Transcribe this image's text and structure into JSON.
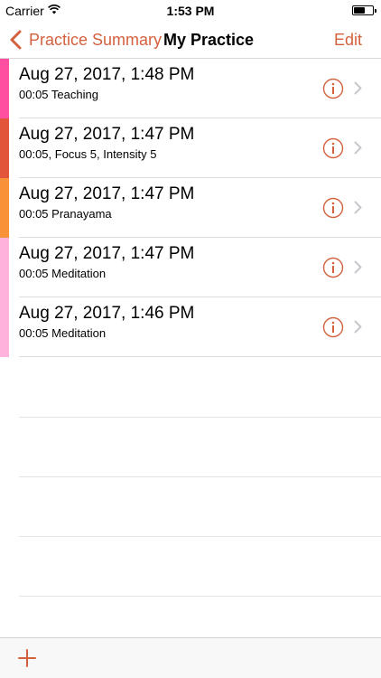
{
  "status_bar": {
    "carrier": "Carrier",
    "time": "1:53 PM",
    "battery_level": 0.6
  },
  "nav": {
    "back_label": "Practice Summary",
    "title": "My Practice",
    "edit_label": "Edit"
  },
  "colors": {
    "accent": "#d3613e"
  },
  "sessions": [
    {
      "title": "Aug 27, 2017, 1:48 PM",
      "subtitle": "00:05 Teaching",
      "color": "#ff4fa0"
    },
    {
      "title": "Aug 27, 2017, 1:47 PM",
      "subtitle": "00:05, Focus 5, Intensity 5",
      "color": "#e2553a"
    },
    {
      "title": "Aug 27, 2017, 1:47 PM",
      "subtitle": "00:05 Pranayama",
      "color": "#f89238"
    },
    {
      "title": "Aug 27, 2017, 1:47 PM",
      "subtitle": "00:05 Meditation",
      "color": "#ffb3dc"
    },
    {
      "title": "Aug 27, 2017, 1:46 PM",
      "subtitle": "00:05 Meditation",
      "color": "#ffb3dc"
    }
  ],
  "toolbar": {
    "add_icon": "plus-icon"
  }
}
